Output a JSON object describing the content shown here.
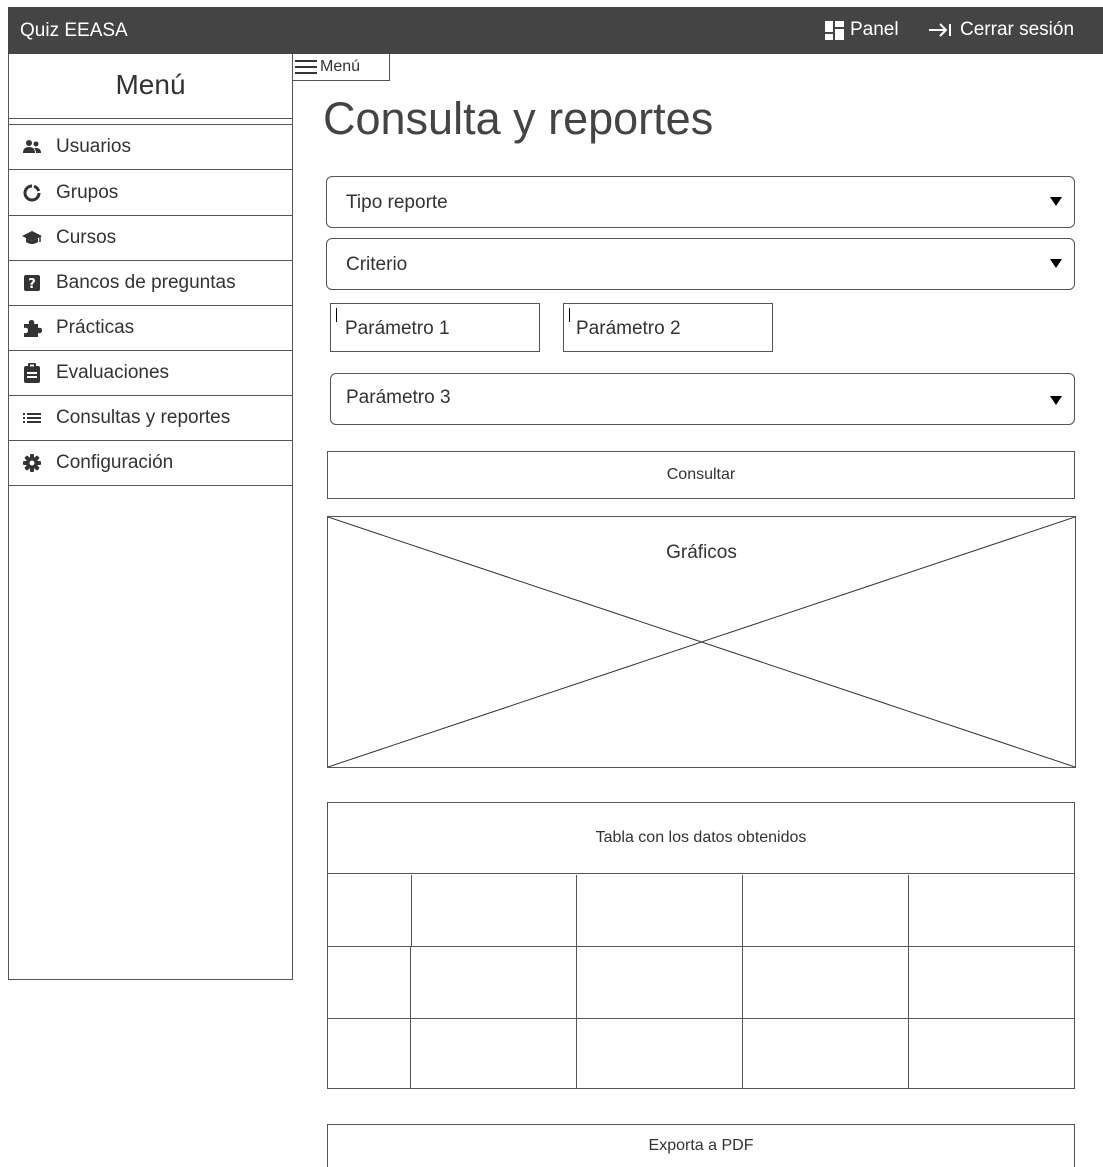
{
  "topbar": {
    "app_title": "Quiz EEASA",
    "panel_label": "Panel",
    "logout_label": "Cerrar sesión"
  },
  "sidebar": {
    "title": "Menú",
    "items": [
      {
        "label": "Usuarios",
        "icon": "users-icon"
      },
      {
        "label": "Grupos",
        "icon": "circle-notch-icon"
      },
      {
        "label": "Cursos",
        "icon": "graduation-cap-icon"
      },
      {
        "label": "Bancos de preguntas",
        "icon": "question-square-icon"
      },
      {
        "label": "Prácticas",
        "icon": "puzzle-icon"
      },
      {
        "label": "Evaluaciones",
        "icon": "clipboard-icon"
      },
      {
        "label": "Consultas y reportes",
        "icon": "list-icon"
      },
      {
        "label": "Configuración",
        "icon": "gear-icon"
      }
    ]
  },
  "menu_toggle": {
    "label": "Menú"
  },
  "page": {
    "title": "Consulta y reportes"
  },
  "form": {
    "tipo_reporte": "Tipo reporte",
    "criterio": "Criterio",
    "parametro1": "Parámetro 1",
    "parametro2": "Parámetro 2",
    "parametro3": "Parámetro 3",
    "consultar": "Consultar"
  },
  "graph": {
    "label": "Gráficos"
  },
  "table": {
    "header": "Tabla con los datos obtenidos",
    "rows": 3,
    "columns": 5
  },
  "export": {
    "label": "Exporta a PDF"
  }
}
